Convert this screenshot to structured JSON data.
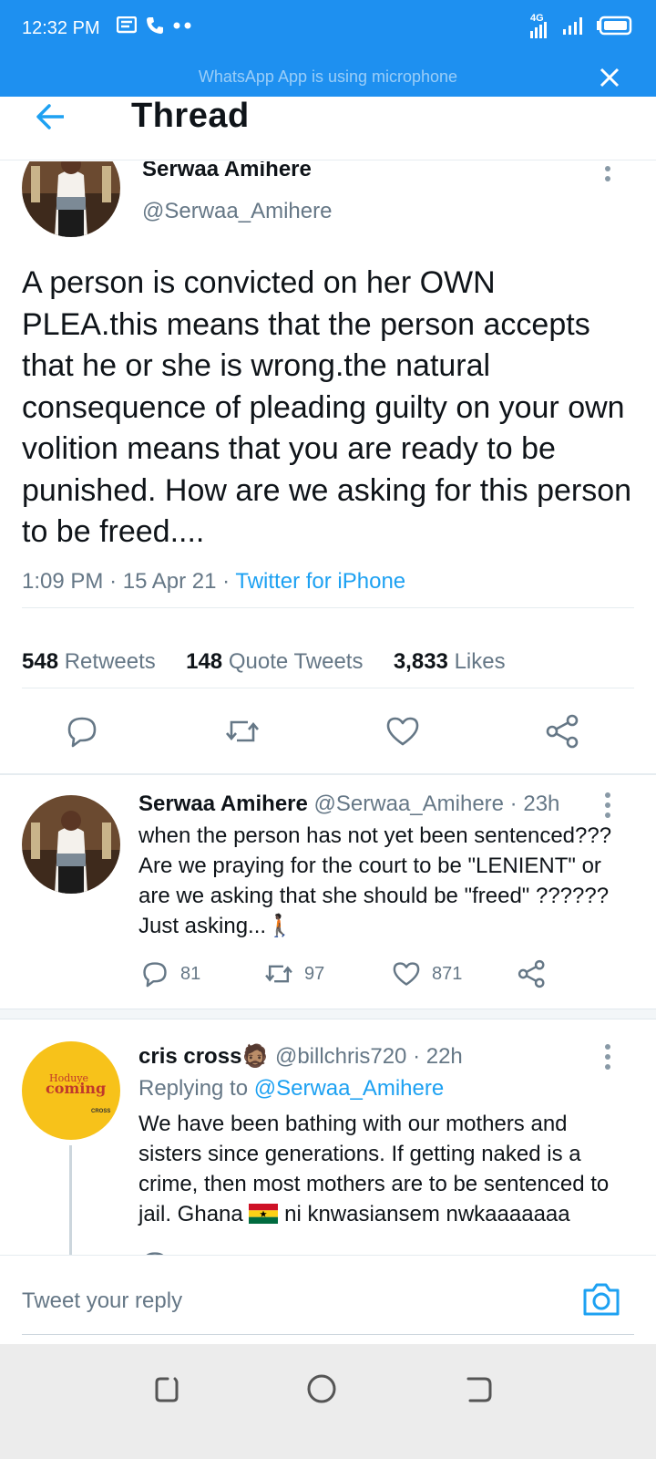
{
  "status_bar": {
    "time": "12:32 PM",
    "network": "4G",
    "mic_banner": "WhatsApp App is using microphone"
  },
  "header": {
    "title": "Thread"
  },
  "main_tweet": {
    "name": "Serwaa Amihere",
    "handle": "@Serwaa_Amihere",
    "text": "A person is convicted on her OWN PLEA.this means that the person accepts that he or she is wrong.the natural consequence of pleading guilty on your own volition means that you are ready to be punished. How are we asking for this  person to be freed....",
    "time": "1:09 PM",
    "date": "15 Apr 21",
    "source": "Twitter for iPhone",
    "retweets": "548",
    "retweets_label": "Retweets",
    "quotes": "148",
    "quotes_label": "Quote Tweets",
    "likes": "3,833",
    "likes_label": "Likes"
  },
  "replies": [
    {
      "name": "Serwaa Amihere",
      "handle": "@Serwaa_Amihere",
      "age": "23h",
      "text": "when the person has not yet been sentenced??? Are we praying for the court to be \"LENIENT\" or are we asking that she should be \"freed\" ?????? Just asking...🚶🏿",
      "replies": "81",
      "retweets": "97",
      "likes": "871"
    },
    {
      "name": "cris cross🧔🏽",
      "handle": "@billchris720",
      "age": "22h",
      "replying_label": "Replying to",
      "replying_to": "@Serwaa_Amihere",
      "avatar_text_top": "Hoduye",
      "avatar_text": "coming",
      "avatar_text_small": "CROSS",
      "text_part1": "We have been bathing with our mothers and sisters since generations. If getting naked is a crime, then most mothers are to be sentenced to jail. Ghana",
      "text_part2": "ni knwasiansem nwkaaaaaaa"
    }
  ],
  "compose": {
    "placeholder": "Tweet your reply"
  },
  "colors": {
    "accent": "#1da1f2",
    "status_bar": "#1e90f0",
    "secondary_text": "#657786"
  }
}
